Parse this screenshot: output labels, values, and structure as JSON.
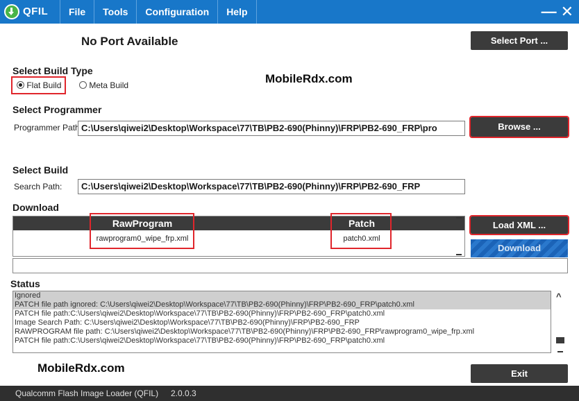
{
  "window": {
    "app_name": "QFIL",
    "menu": [
      "File",
      "Tools",
      "Configuration",
      "Help"
    ],
    "minimize_glyph": "—",
    "close_glyph": "✕"
  },
  "port": {
    "status": "No Port Available",
    "select_button": "Select Port ..."
  },
  "build_type": {
    "title": "Select Build Type",
    "options": [
      {
        "label": "Flat Build",
        "selected": true
      },
      {
        "label": "Meta Build",
        "selected": false
      }
    ]
  },
  "programmer": {
    "title": "Select Programmer",
    "path_label": "Programmer Path",
    "path_value": "C:\\Users\\qiwei2\\Desktop\\Workspace\\77\\TB\\PB2-690(Phinny)\\FRP\\PB2-690_FRP\\pro",
    "browse_button": "Browse ..."
  },
  "select_build": {
    "title": "Select Build",
    "search_label": "Search Path:",
    "search_value": "C:\\Users\\qiwei2\\Desktop\\Workspace\\77\\TB\\PB2-690(Phinny)\\FRP\\PB2-690_FRP"
  },
  "download": {
    "title": "Download",
    "columns": [
      "RawProgram",
      "Patch"
    ],
    "rows": [
      {
        "rawprogram": "rawprogram0_wipe_frp.xml",
        "patch": "patch0.xml"
      }
    ],
    "load_xml_button": "Load XML ...",
    "download_button": "Download"
  },
  "status": {
    "title": "Status",
    "lines": [
      {
        "text": "Ignored",
        "highlight": true
      },
      {
        "text": "PATCH file path ignored: C:\\Users\\qiwei2\\Desktop\\Workspace\\77\\TB\\PB2-690(Phinny)\\FRP\\PB2-690_FRP\\patch0.xml",
        "highlight": true
      },
      {
        "text": "PATCH file path:C:\\Users\\qiwei2\\Desktop\\Workspace\\77\\TB\\PB2-690(Phinny)\\FRP\\PB2-690_FRP\\patch0.xml",
        "highlight": false
      },
      {
        "text": "Image Search Path: C:\\Users\\qiwei2\\Desktop\\Workspace\\77\\TB\\PB2-690(Phinny)\\FRP\\PB2-690_FRP",
        "highlight": false
      },
      {
        "text": "RAWPROGRAM file path: C:\\Users\\qiwei2\\Desktop\\Workspace\\77\\TB\\PB2-690(Phinny)\\FRP\\PB2-690_FRP\\rawprogram0_wipe_frp.xml",
        "highlight": false
      },
      {
        "text": "PATCH file path:C:\\Users\\qiwei2\\Desktop\\Workspace\\77\\TB\\PB2-690(Phinny)\\FRP\\PB2-690_FRP\\patch0.xml",
        "highlight": false
      }
    ]
  },
  "exit_button": "Exit",
  "footer": {
    "product": "Qualcomm Flash Image Loader (QFIL)",
    "version": "2.0.0.3"
  },
  "watermarks": [
    "MobileRdx.com",
    "MobileRdx.com"
  ],
  "colors": {
    "title_bar": "#1877c9",
    "button_dark": "#3b3b3b",
    "highlight_box": "#e0252b",
    "download_button": "#1b63b7"
  }
}
